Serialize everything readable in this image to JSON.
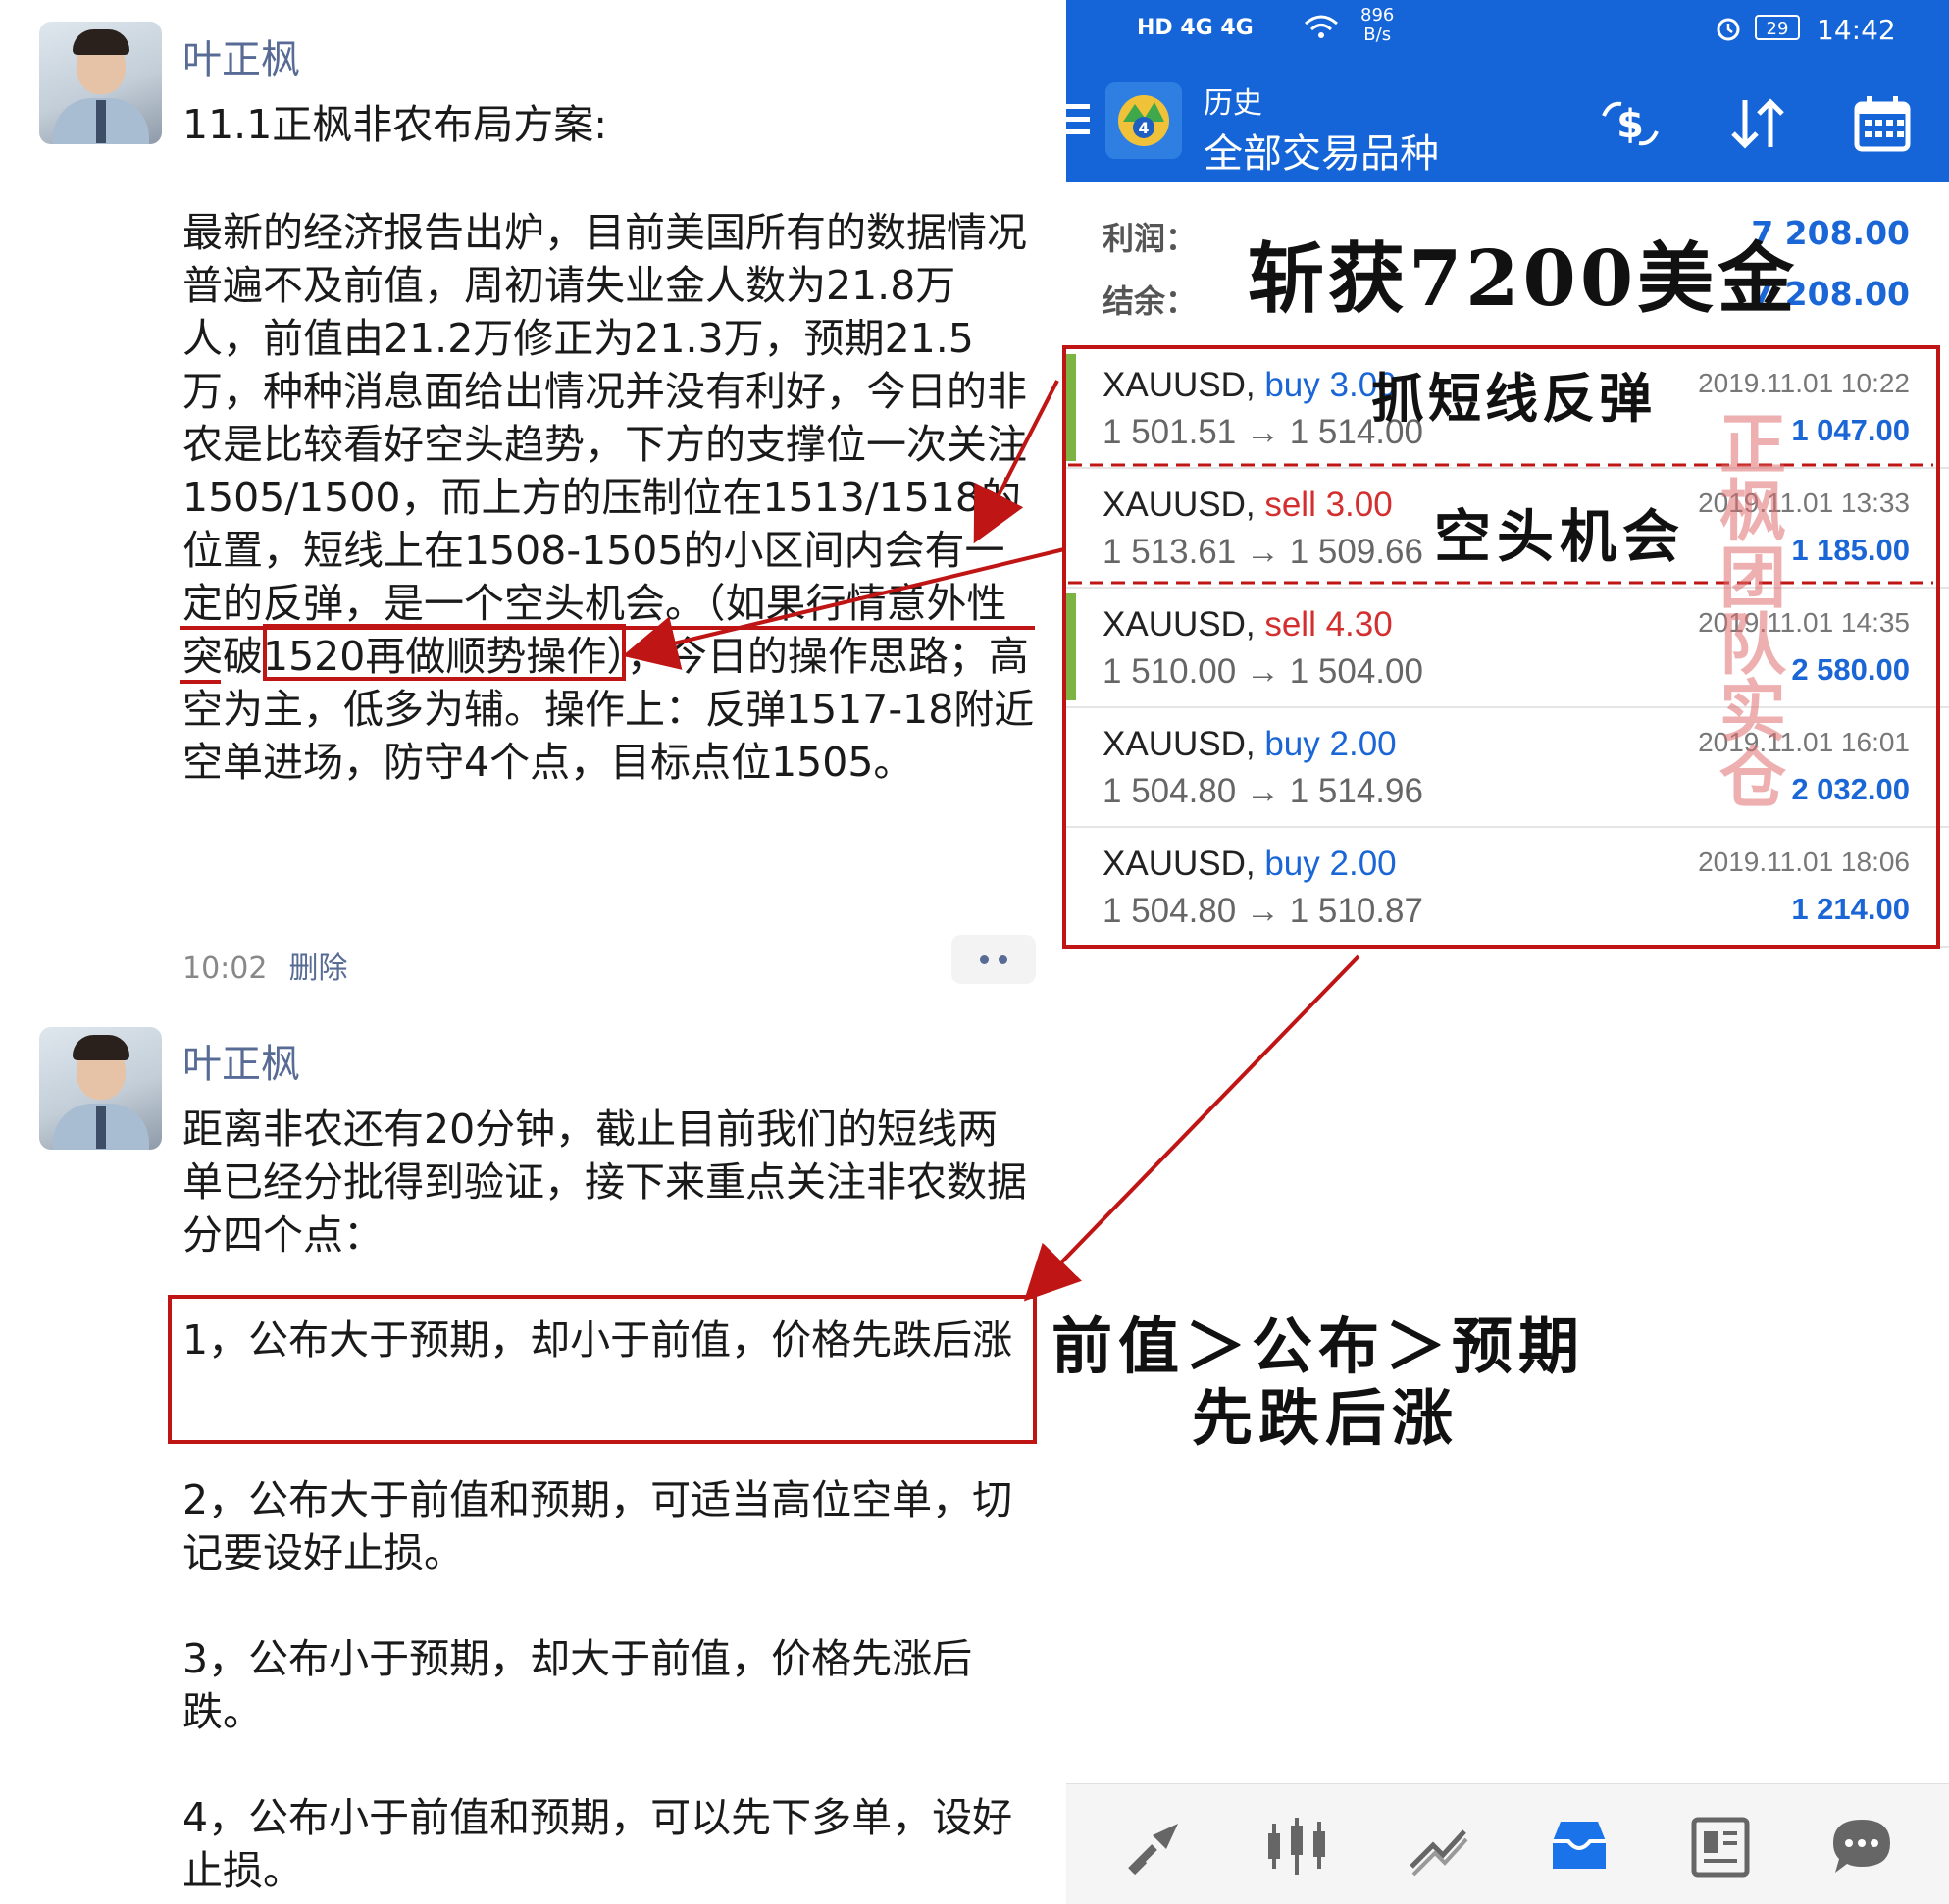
{
  "chat": {
    "messages": [
      {
        "sender": "叶正枫",
        "title": "11.1正枫非农布局方案:",
        "body": "最新的经济报告出炉，目前美国所有的数据情况普遍不及前值，周初请失业金人数为21.8万人，前值由21.2万修正为21.3万，预期21.5万，种种消息面给出情况并没有利好，今日的非农是比较看好空头趋势，下方的支撑位一次关注1505/1500，而上方的压制位在1513/1518的位置，短线上在1508-1505的小区间内会有一定的反弹，是一个空头机会。（如果行情意外性突破1520再做顺势操作），今日的操作思路；高空为主，低多为辅。操作上：反弹1517-18附近空单进场，防守4个点，目标点位1505。",
        "time": "10:02",
        "delete_label": "删除"
      },
      {
        "sender": "叶正枫",
        "intro": "距离非农还有20分钟，截止目前我们的短线两单已经分批得到验证，接下来重点关注非农数据分四个点：",
        "points": [
          "1，公布大于预期，却小于前值，价格先跌后涨",
          "2，公布大于前值和预期，可适当高位空单，切记要设好止损。",
          "3，公布小于预期，却大于前值，价格先涨后跌。",
          "4，公布小于前值和预期，可以先下多单，设好止损。"
        ]
      }
    ]
  },
  "app": {
    "statusbar": {
      "left_icons": "HD 4G 4G",
      "speed_value": "896",
      "speed_unit": "B/s",
      "battery": "29",
      "time": "14:42"
    },
    "header": {
      "title": "历史",
      "subtitle": "全部交易品种"
    },
    "summary": {
      "profit_label": "利润：",
      "profit_value": "7 208.00",
      "balance_label": "结余：",
      "balance_value": "7 208.00"
    },
    "trades": [
      {
        "symbol": "XAUUSD,",
        "side": "buy",
        "volume": "3.00",
        "open": "1 501.51",
        "close": "1 514.00",
        "time": "2019.11.01 10:22",
        "profit": "1 047.00",
        "accent": true
      },
      {
        "symbol": "XAUUSD,",
        "side": "sell",
        "volume": "3.00",
        "open": "1 513.61",
        "close": "1 509.66",
        "time": "2019.11.01 13:33",
        "profit": "1 185.00",
        "accent": false
      },
      {
        "symbol": "XAUUSD,",
        "side": "sell",
        "volume": "4.30",
        "open": "1 510.00",
        "close": "1 504.00",
        "time": "2019.11.01 14:35",
        "profit": "2 580.00",
        "accent": true
      },
      {
        "symbol": "XAUUSD,",
        "side": "buy",
        "volume": "2.00",
        "open": "1 504.80",
        "close": "1 514.96",
        "time": "2019.11.01 16:01",
        "profit": "2 032.00",
        "accent": false
      },
      {
        "symbol": "XAUUSD,",
        "side": "buy",
        "volume": "2.00",
        "open": "1 504.80",
        "close": "1 510.87",
        "time": "2019.11.01 18:06",
        "profit": "1 214.00",
        "accent": false
      }
    ],
    "arrow_glyph": "→",
    "colors": {
      "brand_blue": "#1565d8",
      "buy": "#1a66d6",
      "sell": "#d32f2f",
      "profit": "#1a66d6",
      "annotation_red": "#c01515"
    },
    "bottom_nav": [
      "trade-icon",
      "quotes-icon",
      "chart-icon",
      "history-icon",
      "news-icon",
      "chat-icon"
    ]
  },
  "annotations": {
    "headline": "斩获7200美金",
    "short_rebound": "抓短线反弹",
    "short_opportunity": "空头机会",
    "stamp": "正枫团队实仓",
    "conclusion_line1": "前值＞公布＞预期",
    "conclusion_line2": "先跌后涨"
  }
}
